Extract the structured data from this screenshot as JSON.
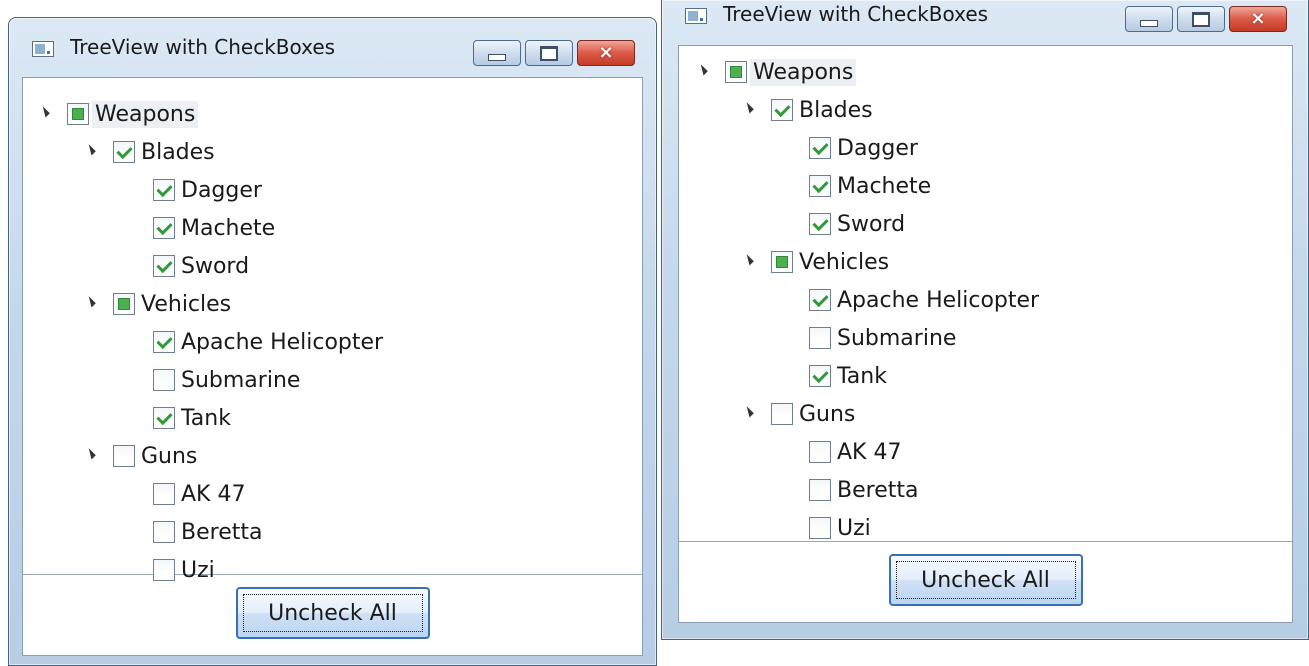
{
  "windows": [
    {
      "title": "TreeView with CheckBoxes",
      "buttons": {
        "minimize": "minimize",
        "maximize": "maximize",
        "close": "×"
      },
      "tree": [
        {
          "label": "Weapons",
          "state": "indeterminate",
          "level": 0,
          "expandable": true
        },
        {
          "label": "Blades",
          "state": "checked",
          "level": 1,
          "expandable": true
        },
        {
          "label": "Dagger",
          "state": "checked",
          "level": 2,
          "expandable": false
        },
        {
          "label": "Machete",
          "state": "checked",
          "level": 2,
          "expandable": false
        },
        {
          "label": "Sword",
          "state": "checked",
          "level": 2,
          "expandable": false
        },
        {
          "label": "Vehicles",
          "state": "indeterminate",
          "level": 1,
          "expandable": true
        },
        {
          "label": "Apache Helicopter",
          "state": "checked",
          "level": 2,
          "expandable": false
        },
        {
          "label": "Submarine",
          "state": "unchecked",
          "level": 2,
          "expandable": false
        },
        {
          "label": "Tank",
          "state": "checked",
          "level": 2,
          "expandable": false
        },
        {
          "label": "Guns",
          "state": "unchecked",
          "level": 1,
          "expandable": true
        },
        {
          "label": "AK 47",
          "state": "unchecked",
          "level": 2,
          "expandable": false
        },
        {
          "label": "Beretta",
          "state": "unchecked",
          "level": 2,
          "expandable": false
        },
        {
          "label": "Uzi",
          "state": "unchecked",
          "level": 2,
          "expandable": false
        }
      ],
      "action_button": "Uncheck All"
    },
    {
      "title": "TreeView with CheckBoxes",
      "buttons": {
        "minimize": "minimize",
        "maximize": "maximize",
        "close": "×"
      },
      "tree": [
        {
          "label": "Weapons",
          "state": "indeterminate",
          "level": 0,
          "expandable": true
        },
        {
          "label": "Blades",
          "state": "checked",
          "level": 1,
          "expandable": true
        },
        {
          "label": "Dagger",
          "state": "checked",
          "level": 2,
          "expandable": false
        },
        {
          "label": "Machete",
          "state": "checked",
          "level": 2,
          "expandable": false
        },
        {
          "label": "Sword",
          "state": "checked",
          "level": 2,
          "expandable": false
        },
        {
          "label": "Vehicles",
          "state": "indeterminate",
          "level": 1,
          "expandable": true
        },
        {
          "label": "Apache Helicopter",
          "state": "checked",
          "level": 2,
          "expandable": false
        },
        {
          "label": "Submarine",
          "state": "unchecked",
          "level": 2,
          "expandable": false
        },
        {
          "label": "Tank",
          "state": "checked",
          "level": 2,
          "expandable": false
        },
        {
          "label": "Guns",
          "state": "unchecked",
          "level": 1,
          "expandable": true
        },
        {
          "label": "AK 47",
          "state": "unchecked",
          "level": 2,
          "expandable": false
        },
        {
          "label": "Beretta",
          "state": "unchecked",
          "level": 2,
          "expandable": false
        },
        {
          "label": "Uzi",
          "state": "unchecked",
          "level": 2,
          "expandable": false
        }
      ],
      "action_button": "Uncheck All"
    }
  ],
  "colors": {
    "check": "#2f9a3a",
    "indeterminate": "#4caf50",
    "frame": "#c4d8ec",
    "close_button": "#dc5a46"
  }
}
